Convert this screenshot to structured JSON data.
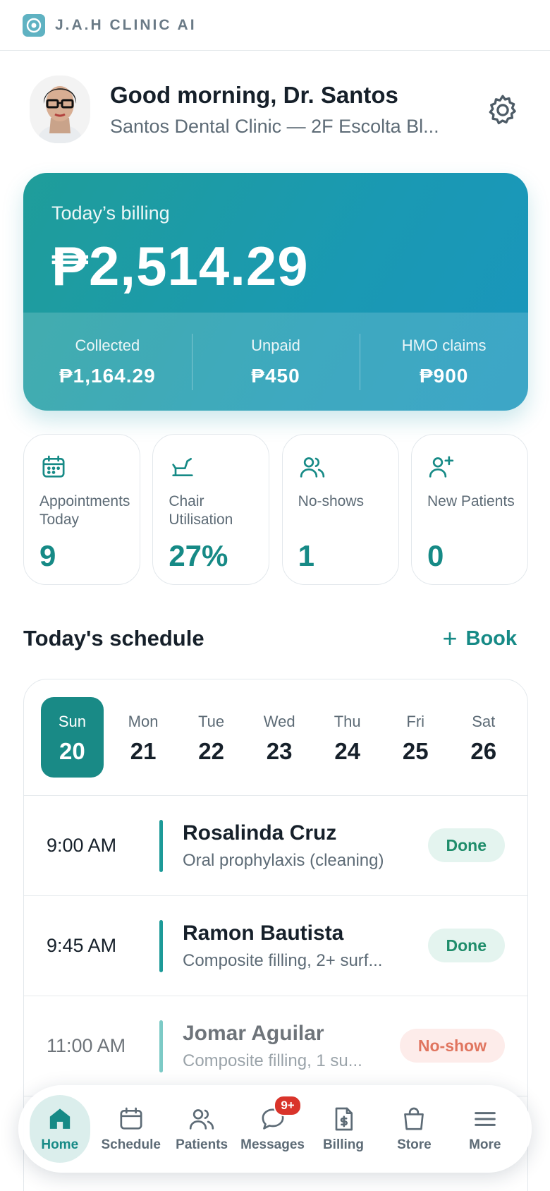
{
  "app": {
    "title": "J.A.H CLINIC AI"
  },
  "greeting": {
    "title": "Good morning, Dr. Santos",
    "clinic": "Santos Dental Clinic — 2F Escolta Bl..."
  },
  "billing": {
    "label": "Today’s billing",
    "amount": "₱2,514.29",
    "collected_label": "Collected",
    "collected_value": "₱1,164.29",
    "unpaid_label": "Unpaid",
    "unpaid_value": "₱450",
    "hmo_label": "HMO claims",
    "hmo_value": "₱900"
  },
  "stats": [
    {
      "label": "Appointments Today",
      "value": "9",
      "icon": "calendar-icon"
    },
    {
      "label": "Chair Utilisation",
      "value": "27%",
      "icon": "dental-chair-icon"
    },
    {
      "label": "No-shows",
      "value": "1",
      "icon": "users-icon"
    },
    {
      "label": "New Patients",
      "value": "0",
      "icon": "user-plus-icon"
    }
  ],
  "schedule": {
    "title": "Today's schedule",
    "book_label": "Book",
    "days": [
      {
        "name": "Sun",
        "num": "20"
      },
      {
        "name": "Mon",
        "num": "21"
      },
      {
        "name": "Tue",
        "num": "22"
      },
      {
        "name": "Wed",
        "num": "23"
      },
      {
        "name": "Thu",
        "num": "24"
      },
      {
        "name": "Fri",
        "num": "25"
      },
      {
        "name": "Sat",
        "num": "26"
      }
    ],
    "appointments": [
      {
        "time": "9:00 AM",
        "name": "Rosalinda Cruz",
        "desc": "Oral prophylaxis (cleaning)",
        "status": "Done"
      },
      {
        "time": "9:45 AM",
        "name": "Ramon Bautista",
        "desc": "Composite filling, 2+ surf...",
        "status": "Done"
      },
      {
        "time": "11:00 AM",
        "name": "Jomar Aguilar",
        "desc": "Composite filling, 1 su...",
        "status": "No-show"
      }
    ]
  },
  "nav": {
    "items": [
      {
        "label": "Home",
        "icon": "home-icon"
      },
      {
        "label": "Schedule",
        "icon": "calendar-icon"
      },
      {
        "label": "Patients",
        "icon": "users-icon"
      },
      {
        "label": "Messages",
        "icon": "chat-icon",
        "badge": "9+"
      },
      {
        "label": "Billing",
        "icon": "invoice-icon"
      },
      {
        "label": "Store",
        "icon": "bag-icon"
      },
      {
        "label": "More",
        "icon": "menu-icon"
      }
    ]
  },
  "colors": {
    "accent": "#168a86",
    "brand_gradient_start": "#1f9d9a",
    "brand_gradient_end": "#1996bd",
    "badge_red": "#d9342b"
  }
}
